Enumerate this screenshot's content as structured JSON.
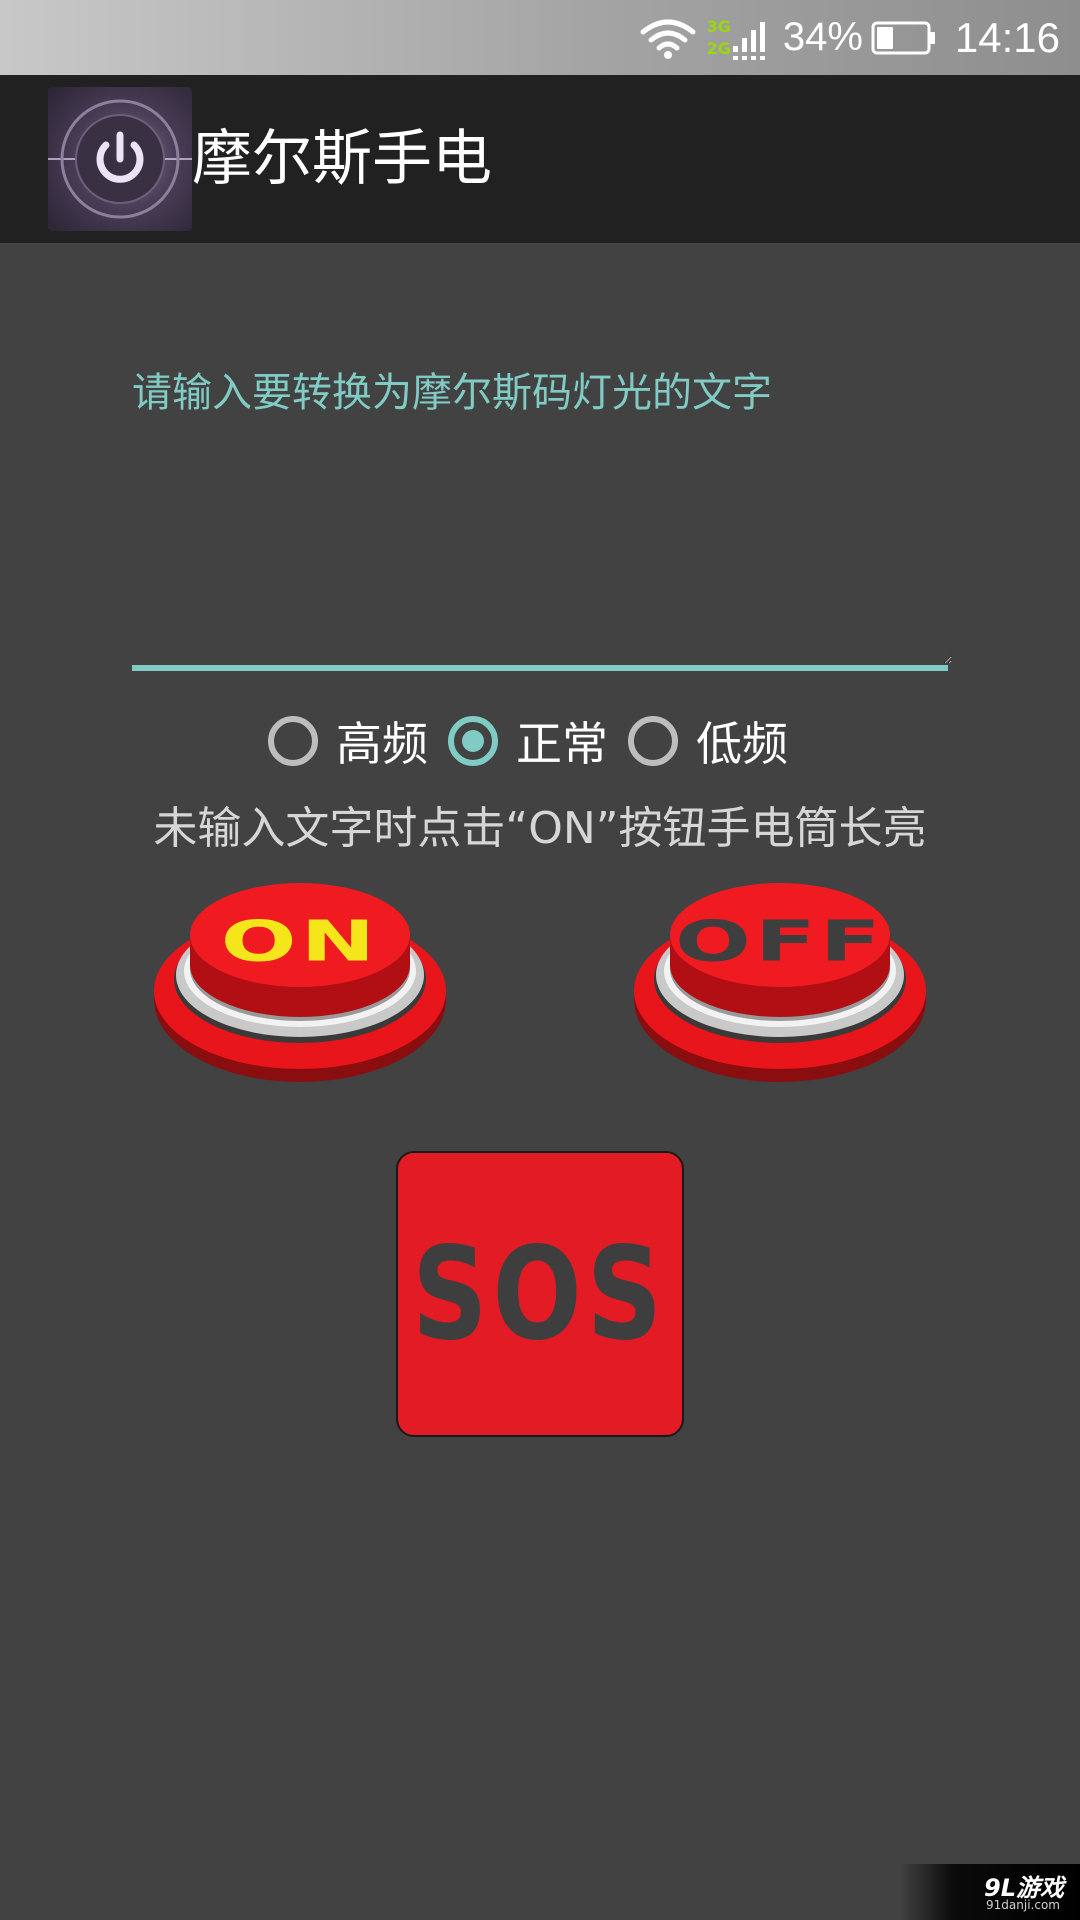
{
  "status_bar": {
    "net_type_top": "3G",
    "net_type_bottom": "2G",
    "battery_percent": "34%",
    "time": "14:16",
    "battery_level": 0.34
  },
  "app_bar": {
    "title": "摩尔斯手电",
    "icon": "power-icon"
  },
  "input": {
    "placeholder": "请输入要转换为摩尔斯码灯光的文字",
    "value": ""
  },
  "frequency": {
    "options": [
      {
        "label": "高频",
        "checked": false
      },
      {
        "label": "正常",
        "checked": true
      },
      {
        "label": "低频",
        "checked": false
      }
    ]
  },
  "info_text": "未输入文字时点击“ON”按钮手电筒长亮",
  "buttons": {
    "on_label": "ON",
    "off_label": "OFF",
    "sos_label": "SOS"
  },
  "watermark": {
    "main": "9L游戏",
    "sub": "91danji.com"
  },
  "colors": {
    "accent": "#80cbc4",
    "button_red": "#e21b24",
    "background": "#424242",
    "app_bar": "#212121"
  }
}
